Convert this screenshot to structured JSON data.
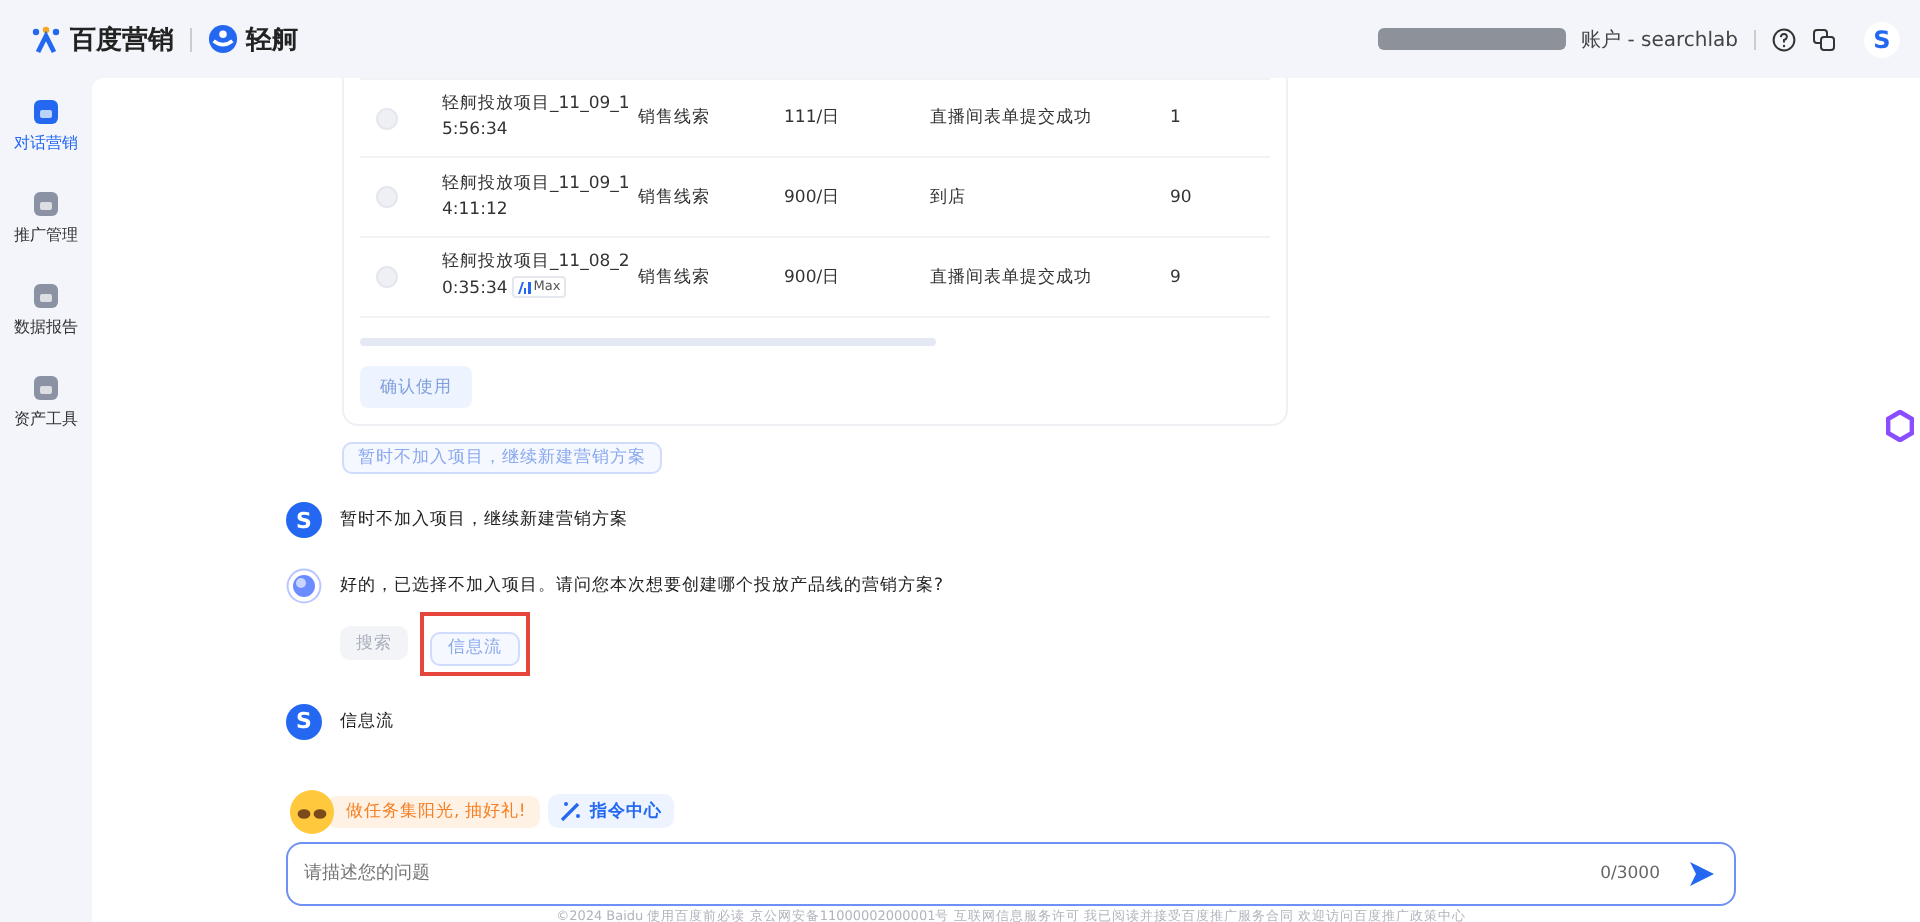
{
  "header": {
    "brand": "百度营销",
    "product": "轻舸",
    "account": "账户 - searchlab",
    "avatar": "S"
  },
  "sidebar": {
    "items": [
      {
        "label": "对话营销",
        "selected": true
      },
      {
        "label": "推广管理",
        "selected": false
      },
      {
        "label": "数据报告",
        "selected": false
      },
      {
        "label": "资产工具",
        "selected": false
      }
    ]
  },
  "project_table": {
    "rows": [
      {
        "checked": false,
        "name": "轻舸投放项目_11_09_15:56:34",
        "type": "销售线索",
        "budget": "111/日",
        "conversion": "直播间表单提交成功",
        "count": "1"
      },
      {
        "checked": false,
        "name": "轻舸投放项目_11_09_14:11:12",
        "type": "销售线索",
        "budget": "900/日",
        "conversion": "到店",
        "count": "90"
      },
      {
        "checked": false,
        "name": "轻舸投放项目_11_08_20:35:34",
        "badge": "Max",
        "type": "销售线索",
        "budget": "900/日",
        "conversion": "直播间表单提交成功",
        "count": "9"
      }
    ],
    "confirm_button": {
      "label": "确认使用",
      "disabled": true
    }
  },
  "skip_chip": "暂时不加入项目，继续新建营销方案",
  "messages": [
    {
      "kind": "user",
      "avatar": "S",
      "text": "暂时不加入项目，继续新建营销方案"
    },
    {
      "kind": "bot",
      "text": "好的，已选择不加入项目。请问您本次想要创建哪个投放产品线的营销方案?",
      "options": [
        {
          "label": "搜索",
          "selected": false
        },
        {
          "label": "信息流",
          "selected": true
        }
      ]
    },
    {
      "kind": "user",
      "avatar": "S",
      "text": "信息流"
    }
  ],
  "promo": {
    "task": "做任务集阳光, 抽好礼!",
    "commands": "指令中心"
  },
  "input": {
    "placeholder": "请描述您的问题",
    "counter": "0/3000"
  },
  "footer": "©2024 Baidu 使用百度前必读 京公网安备11000002000001号 互联网信息服务许可 我已阅读并接受百度推广服务合同 欢迎访问百度推广政策中心"
}
